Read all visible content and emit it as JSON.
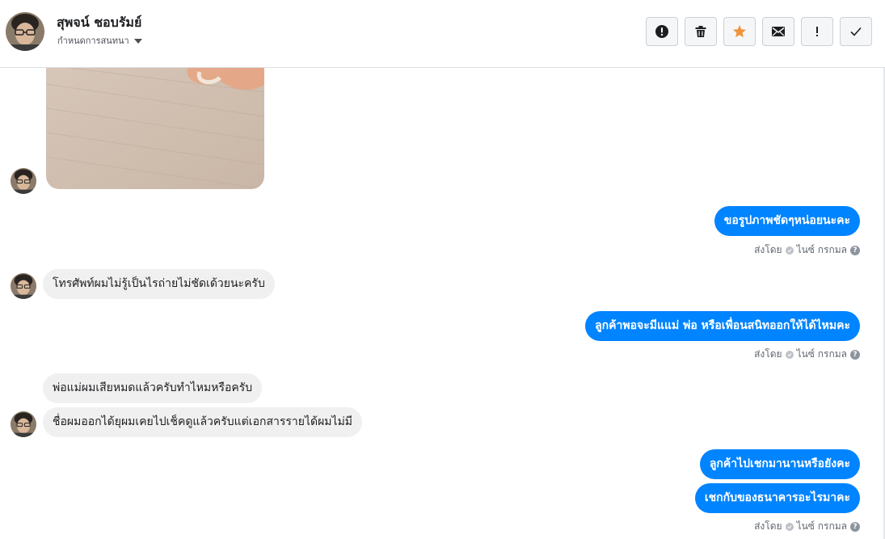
{
  "header": {
    "name": "สุพจน์ ชอบรัมย์",
    "subtitle": "กำหนดการสนทนา",
    "toolbar": [
      {
        "icon": "alert-circle-icon",
        "name": "mark-spam-button"
      },
      {
        "icon": "trash-icon",
        "name": "delete-button"
      },
      {
        "icon": "star-icon",
        "name": "star-button",
        "color": "#f0943b"
      },
      {
        "icon": "envelope-icon",
        "name": "mark-unread-button"
      },
      {
        "icon": "exclamation-icon",
        "name": "follow-up-button"
      },
      {
        "icon": "checkmark-icon",
        "name": "done-button"
      }
    ]
  },
  "messages": {
    "m1": "ขอรูปภาพชัดๆหน่อยนะคะ",
    "m2": "โทรศัพท์ผมไม่รู้เป็นไรถ่ายไม่ชัดเด้วยนะครับ",
    "m3": "ลูกค้าพอจะมีแแม่ พ่อ หรือเพื่อนสนิทออกให้ได้ไหมคะ",
    "m4": "พ่อแม่ผมเสียหมดแล้วครับทำไหมหรือครับ",
    "m5": "ชื่อผมออกได้ยุผมเคยไปเช็คดูแล้วครับแต่เอกสารรายได้ผมไม่มี",
    "m6": "ลูกค้าไปเชกมานานหรือยังคะ",
    "m7": "เชกกับของธนาคารอะไรมาคะ"
  },
  "meta": {
    "sent_by": "ส่งโดย",
    "sender": "ไนซ์ กรกมล",
    "help": "?"
  },
  "colors": {
    "outgoing_bubble": "#0084ff",
    "incoming_bubble": "#f1f0f0",
    "star": "#f0943b"
  }
}
